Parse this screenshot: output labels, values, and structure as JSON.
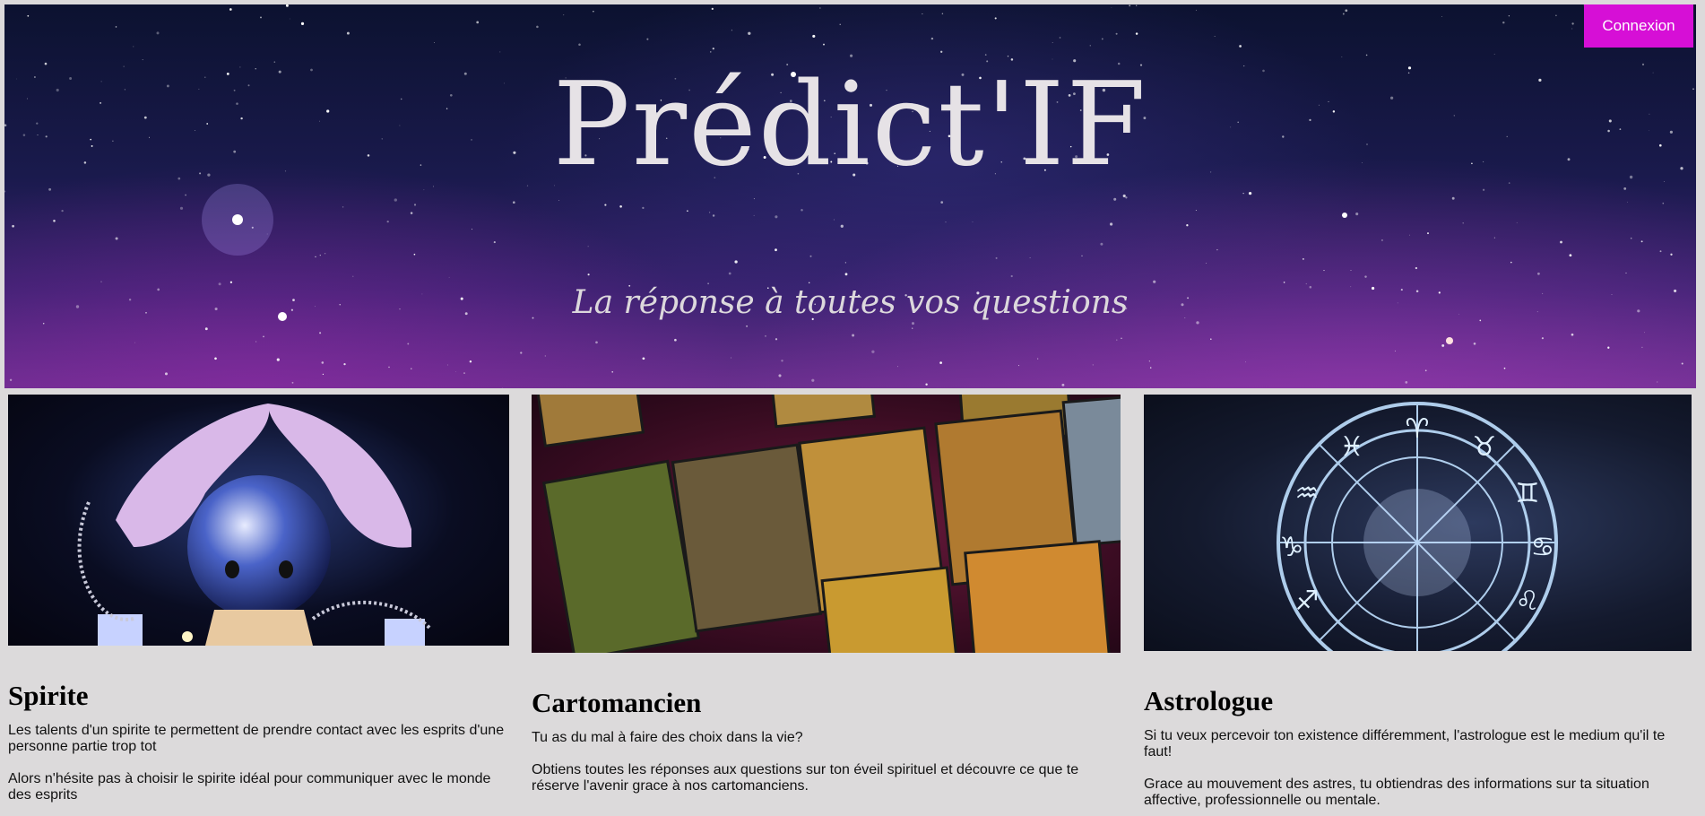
{
  "header": {
    "title": "Prédict'IF",
    "tagline": "La réponse à toutes vos questions",
    "login_label": "Connexion"
  },
  "colors": {
    "accent": "#d60fd6",
    "page_background": "#dcdadb"
  },
  "cards": [
    {
      "title": "Spirite",
      "image": "crystal-ball-image",
      "paragraphs": [
        "Les talents d'un spirite te permettent de prendre contact avec les esprits d'une personne partie trop tot",
        "Alors n'hésite pas à choisir le spirite idéal pour communiquer avec le monde des esprits"
      ]
    },
    {
      "title": "Cartomancien",
      "image": "tarot-cards-image",
      "paragraphs": [
        "Tu as du mal à faire des choix dans la vie?",
        "Obtiens toutes les réponses aux questions sur ton éveil spirituel et découvre ce que te réserve l'avenir grace à nos cartomanciens."
      ]
    },
    {
      "title": "Astrologue",
      "image": "zodiac-wheel-image",
      "paragraphs": [
        "Si tu veux percevoir ton existence différemment, l'astrologue est le medium qu'il te faut!",
        "Grace au mouvement des astres, tu obtiendras des informations sur ta situation affective, professionnelle ou mentale."
      ]
    }
  ]
}
